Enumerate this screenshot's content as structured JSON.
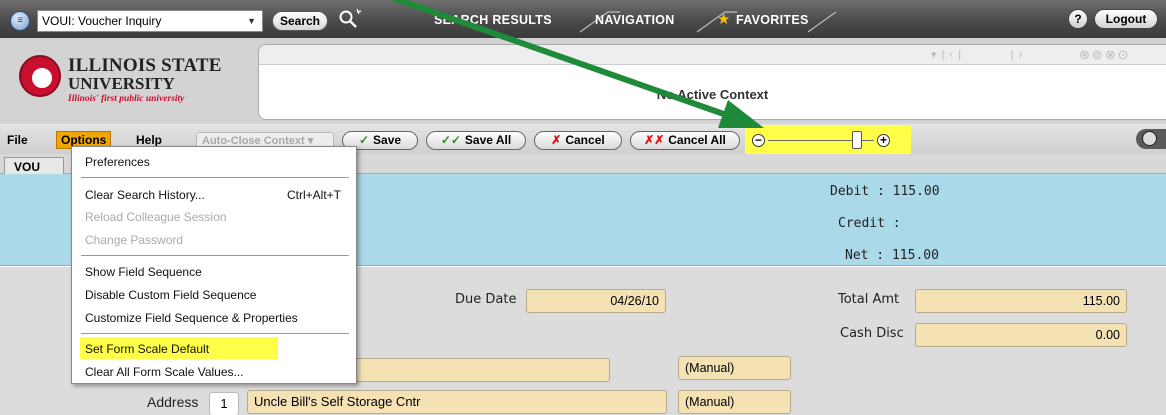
{
  "topbar": {
    "form_name": "VOUI: Voucher Inquiry",
    "search_label": "Search",
    "tabs": {
      "search_results": "SEARCH RESULTS",
      "navigation": "NAVIGATION",
      "favorites": "FAVORITES"
    },
    "help_label": "?",
    "logout_label": "Logout"
  },
  "header": {
    "logo_line1": "ILLINOIS STATE",
    "logo_line2": "UNIVERSITY",
    "logo_tagline": "Illinois' first public university",
    "context_text": "No Active Context"
  },
  "menubar": {
    "file": "File",
    "options": "Options",
    "help": "Help",
    "auto_close": "Auto-Close Context ▾",
    "save": "Save",
    "save_all": "Save All",
    "cancel": "Cancel",
    "cancel_all": "Cancel All",
    "zoom_level": 0.84
  },
  "form": {
    "tab_label": "VOU",
    "debit": "Debit : 115.00",
    "credit": "Credit :",
    "net": "Net : 115.00",
    "due_date_label": "Due Date",
    "due_date_value": "04/26/10",
    "total_amt_label": "Total Amt",
    "total_amt_value": "115.00",
    "cash_disc_label": "Cash Disc",
    "cash_disc_value": "0.00",
    "name_value": "",
    "manual_1": "(Manual)",
    "address_label": "Address",
    "address_seq": "1",
    "address_value": "Uncle Bill's Self Storage Cntr",
    "manual_2": "(Manual)"
  },
  "options_menu": {
    "preferences": "Preferences",
    "clear_search_history": "Clear Search History...",
    "clear_search_history_shortcut": "Ctrl+Alt+T",
    "reload_session": "Reload Colleague Session",
    "change_password": "Change Password",
    "show_field_sequence": "Show Field Sequence",
    "disable_custom_sequence": "Disable Custom Field Sequence",
    "customize_sequence": "Customize Field Sequence & Properties",
    "set_form_scale_default": "Set Form Scale Default",
    "clear_form_scale": "Clear All Form Scale Values..."
  },
  "colors": {
    "options_active": "#f1a500",
    "highlight": "#ffff4a",
    "arrow": "#1f8a3a",
    "totals_panel": "#abd9e9",
    "field_fill": "#f4e2b4",
    "brand_red": "#c8102e"
  }
}
